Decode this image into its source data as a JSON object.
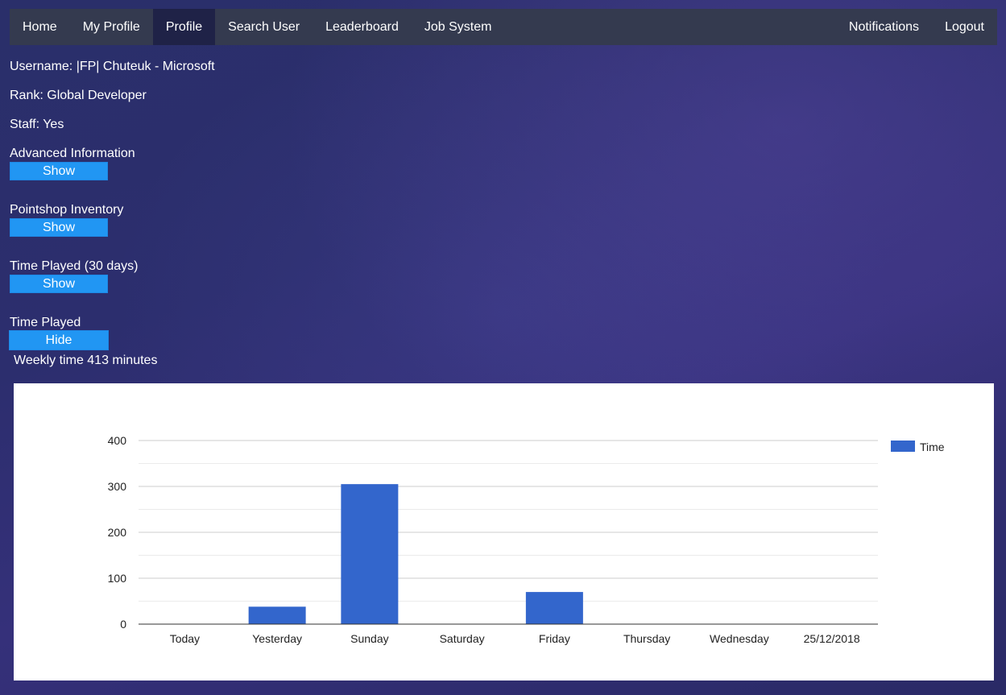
{
  "nav": {
    "left": [
      {
        "label": "Home",
        "name": "nav-home",
        "active": false
      },
      {
        "label": "My Profile",
        "name": "nav-my-profile",
        "active": false
      },
      {
        "label": "Profile",
        "name": "nav-profile",
        "active": true
      },
      {
        "label": "Search User",
        "name": "nav-search-user",
        "active": false
      },
      {
        "label": "Leaderboard",
        "name": "nav-leaderboard",
        "active": false
      },
      {
        "label": "Job System",
        "name": "nav-job-system",
        "active": false
      }
    ],
    "right": [
      {
        "label": "Notifications",
        "name": "nav-notifications",
        "active": false
      },
      {
        "label": "Logout",
        "name": "nav-logout",
        "active": false
      }
    ]
  },
  "profile": {
    "username": "Username: |FP| Chuteuk - Microsoft",
    "rank": "Rank: Global Developer",
    "staff": "Staff: Yes"
  },
  "sections": {
    "advanced": {
      "label": "Advanced Information",
      "button": "Show"
    },
    "pointshop": {
      "label": "Pointshop Inventory",
      "button": "Show"
    },
    "time30": {
      "label": "Time Played (30 days)",
      "button": "Show"
    },
    "timeplayed": {
      "label": "Time Played",
      "button": "Hide"
    }
  },
  "weekly": "Weekly time 413 minutes",
  "colors": {
    "button": "#2196f3",
    "navbar": "#343a4f",
    "nav_active": "#1f2247",
    "bar": "#3366cc"
  },
  "chart_data": {
    "type": "bar",
    "categories": [
      "Today",
      "Yesterday",
      "Sunday",
      "Saturday",
      "Friday",
      "Thursday",
      "Wednesday",
      "25/12/2018"
    ],
    "series": [
      {
        "name": "Time",
        "values": [
          0,
          38,
          305,
          0,
          70,
          0,
          0,
          0
        ]
      }
    ],
    "ylim": [
      0,
      400
    ],
    "yticks": [
      0,
      100,
      200,
      300,
      400
    ],
    "grid": true,
    "legend": "right",
    "title": "",
    "xlabel": "",
    "ylabel": ""
  }
}
